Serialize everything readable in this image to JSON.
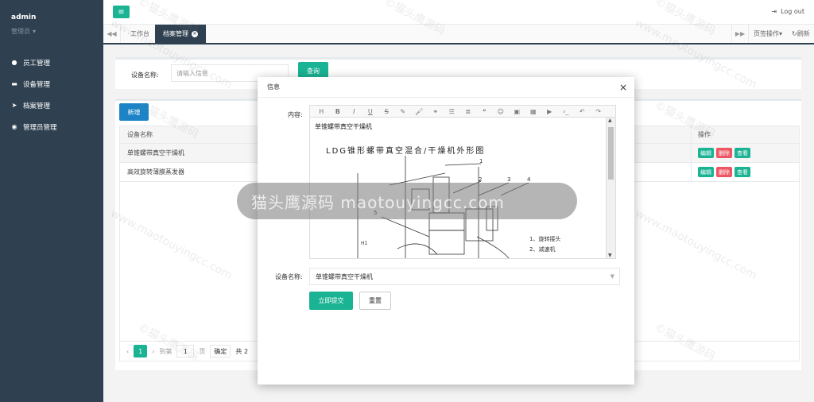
{
  "sidebar": {
    "user": "admin",
    "role": "管理员",
    "items": [
      {
        "label": "员工管理",
        "icon": "user-icon"
      },
      {
        "label": "设备管理",
        "icon": "comments-icon"
      },
      {
        "label": "档案管理",
        "icon": "send-icon"
      },
      {
        "label": "管理员管理",
        "icon": "user-circle-icon"
      }
    ]
  },
  "topbar": {
    "logout": "Log out"
  },
  "tabs": {
    "items": [
      {
        "label": "工作台"
      },
      {
        "label": "档案管理"
      }
    ],
    "page_ops": "页签操作",
    "refresh": "刷新"
  },
  "search": {
    "label": "设备名称:",
    "placeholder": "请输入信息",
    "button": "查询"
  },
  "table": {
    "add_button": "新增",
    "headers": {
      "name": "设备名称",
      "ops": "操作"
    },
    "rows": [
      {
        "name": "单锥螺带真空干燥机"
      },
      {
        "name": "高效旋转薄膜蒸发器"
      }
    ],
    "ops": {
      "edit": "编辑",
      "delete": "删除",
      "view": "查看"
    }
  },
  "pager": {
    "current": "1",
    "goto": "到第",
    "page_value": "1",
    "page_unit": "页",
    "confirm": "确定",
    "total": "共 2"
  },
  "modal": {
    "title": "信息",
    "content_label": "内容:",
    "content_line": "单锥螺带真空干燥机",
    "figure_title": "LDG锥形螺带真空混合/干燥机外形图",
    "figure_notes": [
      "1、旋转接头",
      "2、减速机"
    ],
    "figure_numbers": [
      "1",
      "2",
      "3",
      "4",
      "5"
    ],
    "h1_label": "H1",
    "device_label": "设备名称:",
    "device_value": "单锥螺带真空干燥机",
    "submit": "立即提交",
    "reset": "重置"
  },
  "watermark": {
    "text": "©猫头鹰源码",
    "url": "www.maotouyingcc.com",
    "pill": "猫头鹰源码  maotouyingcc.com"
  },
  "colors": {
    "sidebar": "#2f4050",
    "accent": "#1ab394",
    "blue": "#1c84c6",
    "danger": "#ed5565"
  }
}
